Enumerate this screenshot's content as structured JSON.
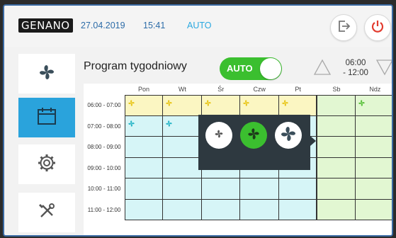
{
  "header": {
    "logo": "GENANO",
    "date": "27.04.2019",
    "time": "15:41",
    "mode": "AUTO"
  },
  "icons": {
    "logout": "logout-icon",
    "power": "power-icon"
  },
  "sidebar": {
    "items": [
      {
        "name": "fan",
        "icon": "fan-icon",
        "active": false
      },
      {
        "name": "calendar",
        "icon": "calendar-icon",
        "active": true
      },
      {
        "name": "settings",
        "icon": "gear-icon",
        "active": false
      },
      {
        "name": "service",
        "icon": "tools-icon",
        "active": false
      }
    ]
  },
  "main": {
    "title": "Program tygodniowy",
    "toggle_label": "AUTO",
    "range_start": "06:00",
    "range_end": "- 12:00"
  },
  "schedule": {
    "days": [
      "Pon",
      "Wt",
      "Śr",
      "Czw",
      "Pt",
      "Sb",
      "Ndz"
    ],
    "slots": [
      "06:00 - 07:00",
      "07:00 - 08:00",
      "08:00 - 09:00",
      "09:00 - 10:00",
      "10:00 - 11:00",
      "11:00 - 12:00"
    ]
  },
  "colors": {
    "accent_blue": "#2aa3dc",
    "auto_green": "#3bbf2f",
    "fan_yellow": "#e8c61a",
    "fan_cyan": "#2ab6c8",
    "fan_green": "#5ac13c",
    "cell_yellow": "#fbf6c2",
    "cell_cyan": "#d6f5f7",
    "cell_green": "#e2f7d2"
  },
  "popup": {
    "options": [
      "fan-low",
      "fan-medium",
      "fan-high"
    ]
  }
}
